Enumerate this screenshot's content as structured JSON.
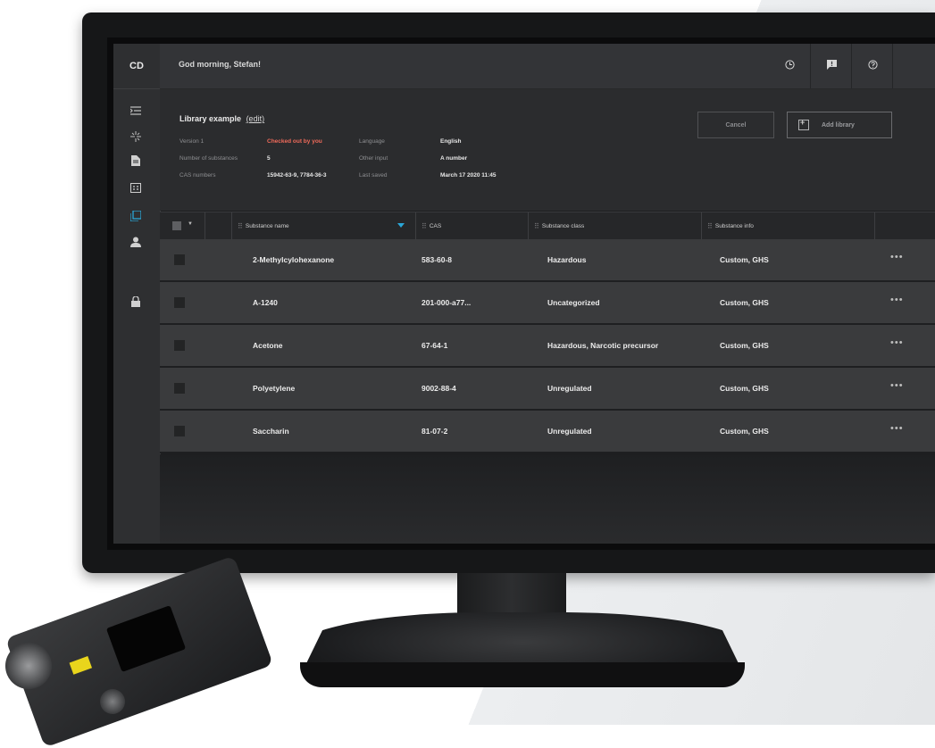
{
  "app": {
    "logo": "CD",
    "greeting": "God morning, Stefan!"
  },
  "header_buttons": [
    "history-icon",
    "feedback-icon",
    "help-icon"
  ],
  "rail_icons": [
    "collapse-menu-icon",
    "scan-icon",
    "document-icon",
    "report-icon",
    "library-icon",
    "user-icon",
    "lock-icon"
  ],
  "library": {
    "title": "Library example",
    "edit_link": "(edit)",
    "meta": {
      "version_label": "Version 1",
      "version_status": "Checked out by you",
      "language_label": "Language",
      "language_value": "English",
      "substances_label": "Number of substances",
      "substances_value": "5",
      "other_input_label": "Other input",
      "other_input_value": "A number",
      "cas_label": "CAS numbers",
      "cas_value": "15942-63-9, 7784-36-3",
      "saved_label": "Last saved",
      "saved_value": "March 17 2020 11:45"
    },
    "cancel_label": "Cancel",
    "add_label": "Add library"
  },
  "table": {
    "columns": [
      "Substance name",
      "CAS",
      "Substance class",
      "Substance info"
    ],
    "rows": [
      {
        "name": "2-Methylcylohexanone",
        "cas": "583-60-8",
        "class": "Hazardous",
        "info": "Custom, GHS"
      },
      {
        "name": "A-1240",
        "cas": "201-000-a77...",
        "class": "Uncategorized",
        "info": "Custom, GHS"
      },
      {
        "name": "Acetone",
        "cas": "67-64-1",
        "class": "Hazardous, Narcotic precursor",
        "info": "Custom, GHS"
      },
      {
        "name": "Polyetylene",
        "cas": "9002-88-4",
        "class": "Unregulated",
        "info": "Custom, GHS"
      },
      {
        "name": "Saccharin",
        "cas": "81-07-2",
        "class": "Unregulated",
        "info": "Custom, GHS"
      }
    ],
    "more_label": "•••"
  },
  "colors": {
    "accent": "#2aa7d8",
    "warning": "#ef6a5a",
    "surface": "#3a3b3d"
  }
}
